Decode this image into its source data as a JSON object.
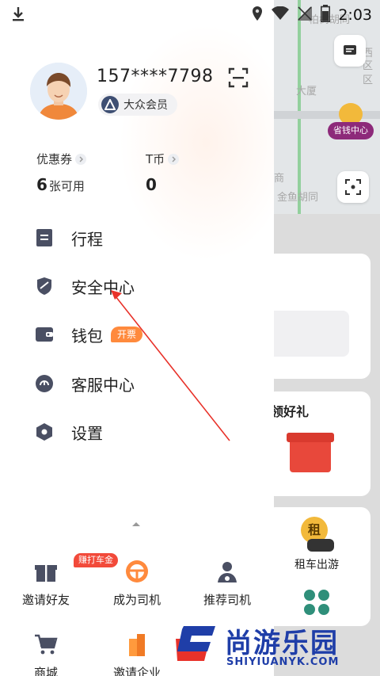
{
  "status_bar": {
    "time": "2:03"
  },
  "map": {
    "labels": [
      "柏树胡同",
      "西",
      "区",
      "区",
      "大厦",
      "商",
      "金鱼胡同"
    ],
    "save_center_label": "省钱中心"
  },
  "background_cards": {
    "promo_title": "领好礼",
    "rent_label": "租车出游",
    "rent_icon_text": "租"
  },
  "profile": {
    "phone": "157****7798",
    "membership": "大众会员"
  },
  "stats": [
    {
      "label": "优惠券",
      "value": "6",
      "unit": "张可用"
    },
    {
      "label": "T币",
      "value": "0",
      "unit": ""
    }
  ],
  "menu": [
    {
      "label": "行程",
      "icon": "list-icon"
    },
    {
      "label": "安全中心",
      "icon": "shield-icon"
    },
    {
      "label": "钱包",
      "icon": "wallet-icon",
      "tag": "开票"
    },
    {
      "label": "客服中心",
      "icon": "headset-icon"
    },
    {
      "label": "设置",
      "icon": "gear-icon"
    }
  ],
  "bottom": [
    {
      "label": "邀请好友",
      "badge": "赚打车金",
      "icon": "gift-icon"
    },
    {
      "label": "成为司机",
      "icon": "steering-wheel-icon"
    },
    {
      "label": "推荐司机",
      "icon": "driver-icon"
    },
    {
      "label": "商城",
      "icon": "cart-icon"
    },
    {
      "label": "邀请企业",
      "icon": "building-icon"
    }
  ],
  "watermark": {
    "cn": "尚游乐园",
    "en": "SHIYIUANYK.COM"
  },
  "colors": {
    "accent_orange": "#ff8a3d",
    "badge_red": "#f24a3a",
    "icon_dark": "#4a4f63",
    "watermark_blue": "#1f3ea8",
    "annotation_red": "#e8322a"
  }
}
